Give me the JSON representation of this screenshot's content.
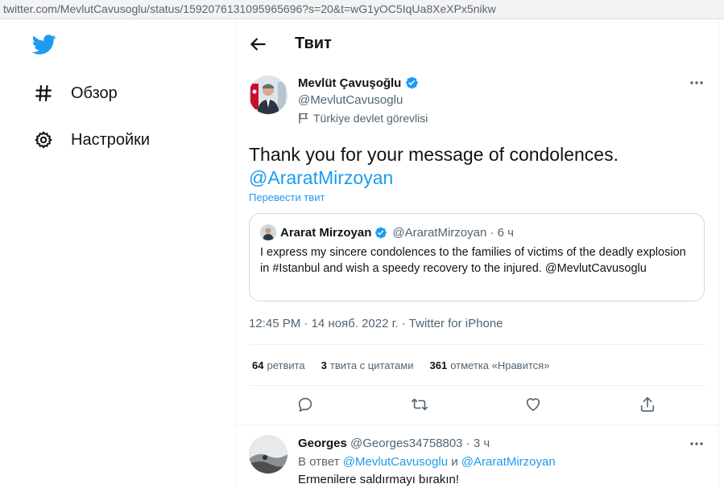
{
  "browser": {
    "url": "twitter.com/MevlutCavusoglu/status/1592076131095965696?s=20&t=wG1yOC5IqUa8XeXPx5nikw"
  },
  "nav": {
    "items": [
      {
        "label": "Обзор",
        "icon": "hashtag-icon"
      },
      {
        "label": "Настройки",
        "icon": "gear-icon"
      }
    ]
  },
  "header": {
    "title": "Твит"
  },
  "tweet": {
    "author_name": "Mevlüt Çavuşoğlu",
    "author_handle": "@MevlutCavusoglu",
    "gov_label": "Türkiye devlet görevlisi",
    "text": "Thank you for your message of condolences.",
    "mention": "@AraratMirzoyan",
    "translate": "Перевести твит",
    "meta": {
      "time": "12:45 PM",
      "date": "14 нояб. 2022 г.",
      "source": "Twitter for iPhone",
      "sep": " · "
    },
    "stats": [
      {
        "count": "64",
        "label": "ретвита"
      },
      {
        "count": "3",
        "label": "твита с цитатами"
      },
      {
        "count": "361",
        "label": "отметка «Нравится»"
      }
    ]
  },
  "quote": {
    "name": "Ararat Mirzoyan",
    "handle": "@AraratMirzoyan",
    "time": "6 ч",
    "text": "I express my sincere condolences to the families of victims of the deadly explosion in #Istanbul and wish a speedy recovery to the injured. @MevlutCavusoglu"
  },
  "reply": {
    "name": "Georges",
    "handle": "@Georges34758803",
    "time": "3 ч",
    "reply_prefix": "В ответ",
    "reply_to_1": "@MevlutCavusoglu",
    "reply_and": "и",
    "reply_to_2": "@AraratMirzoyan",
    "text": "Ermenilere saldırmayı bırakın!"
  },
  "colors": {
    "accent": "#1d9bf0",
    "text": "#0f1419",
    "muted": "#536471",
    "border": "#cfd9de"
  }
}
